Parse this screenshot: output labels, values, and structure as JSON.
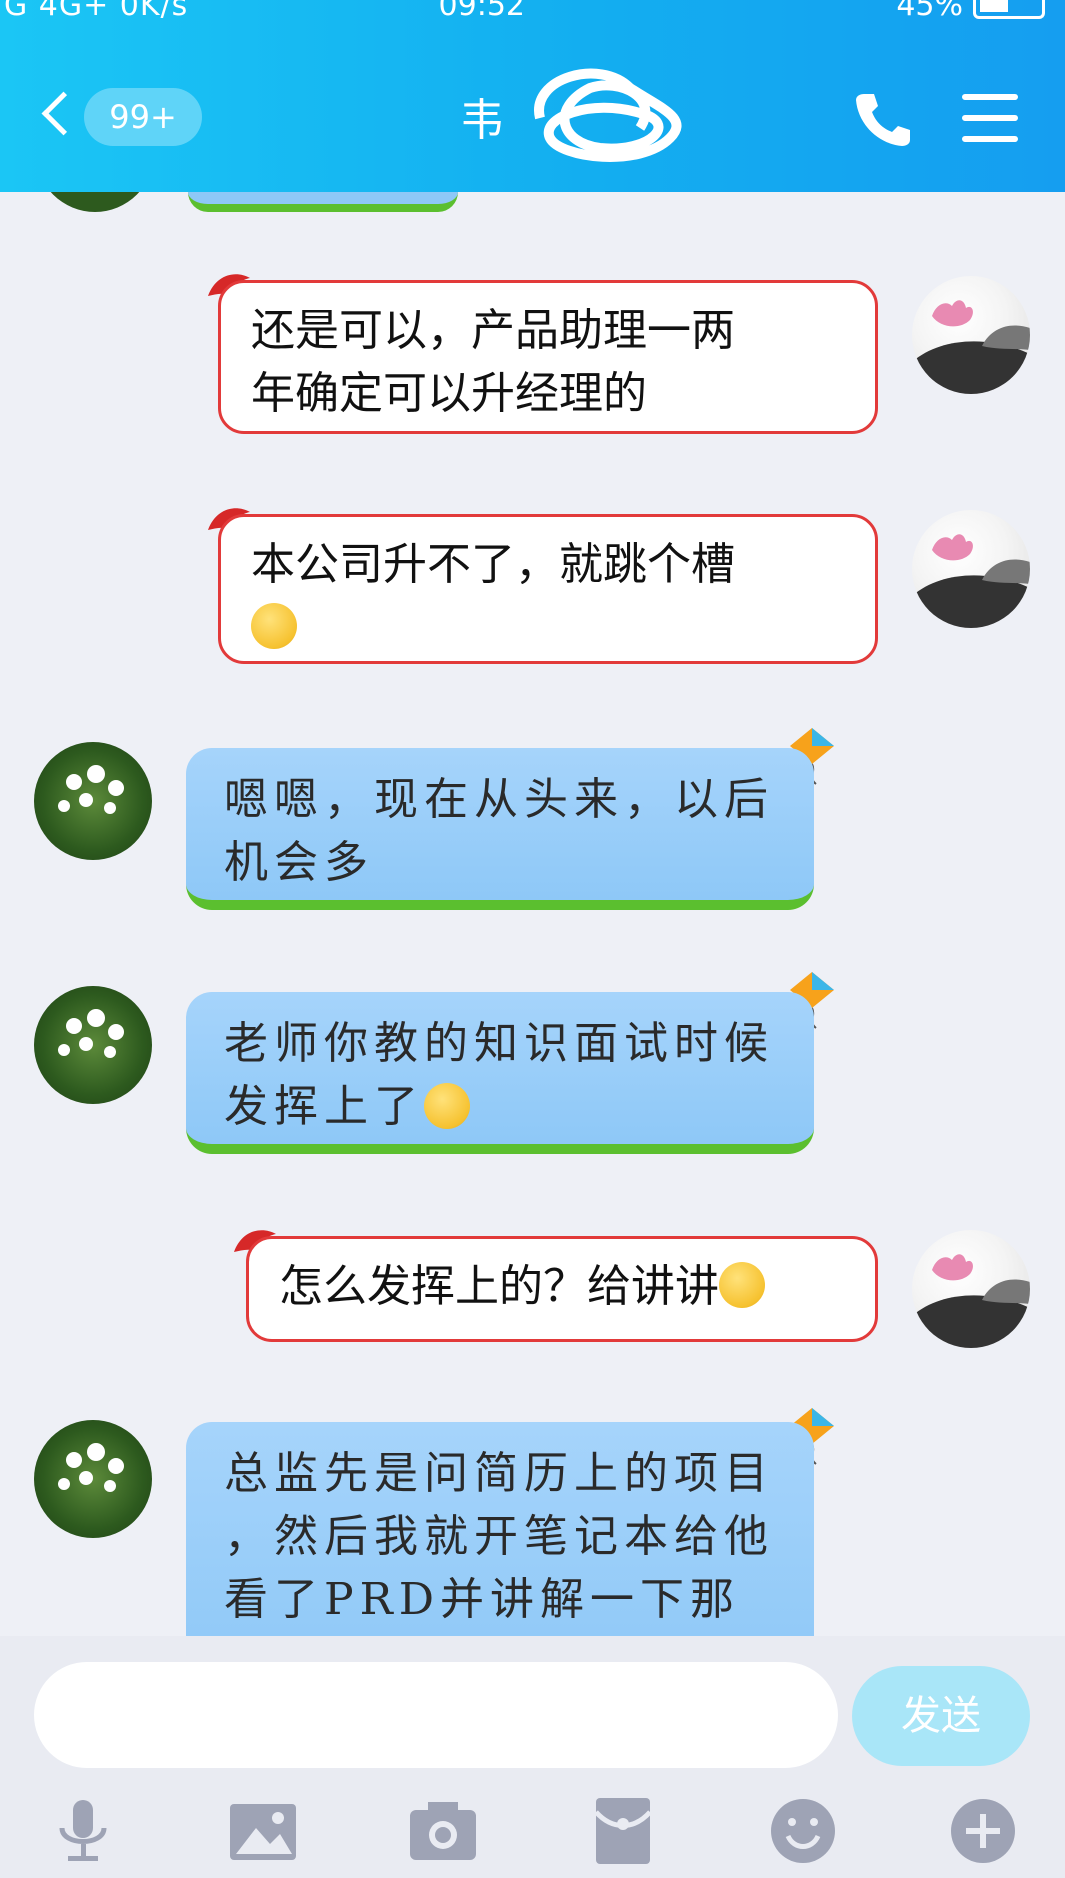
{
  "status_bar": {
    "left_text": "G 4G+ 0K/s",
    "time": "09:52",
    "battery": "45%"
  },
  "header": {
    "back_badge": "99+",
    "contact_name": "韦"
  },
  "messages": [
    {
      "from": "me",
      "text": "还是可以，产品助理一两\n年确定可以升经理的"
    },
    {
      "from": "me",
      "text": "本公司升不了，就跳个槽",
      "emoji": "grin-emoji"
    },
    {
      "from": "other",
      "text": "嗯嗯，现在从头来，以后\n机会多"
    },
    {
      "from": "other",
      "text": "老师你教的知识面试时候\n发挥上了",
      "emoji": "thinking-emoji"
    },
    {
      "from": "me",
      "text": "怎么发挥上的？给讲讲",
      "emoji": "smirk-emoji"
    },
    {
      "from": "other",
      "text": "总监先是问简历上的项目\n，然后我就开笔记本给他\n看了PRD并讲解一下那个"
    }
  ],
  "input": {
    "placeholder": "",
    "send_label": "发送"
  },
  "toolbar": [
    "microphone-icon",
    "image-icon",
    "camera-icon",
    "red-packet-icon",
    "emoji-icon",
    "plus-icon"
  ],
  "colors": {
    "header": "#13aef0",
    "me_bubble_border": "#e23a3a",
    "other_bubble": "#8ec8f7",
    "send_button": "#a9e6f8"
  }
}
